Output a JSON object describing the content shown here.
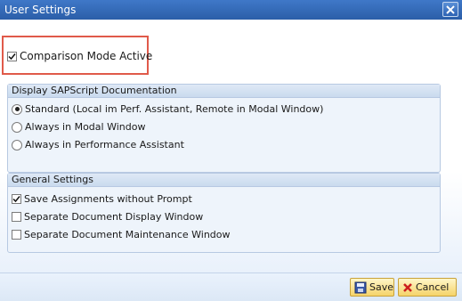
{
  "window": {
    "title": "User Settings",
    "close_icon": "close-icon"
  },
  "comparison_mode": {
    "label": "Comparison Mode Active",
    "checked": true
  },
  "doc_group": {
    "title": "Display SAPScript Documentation",
    "options": [
      {
        "label": "Standard (Local im Perf. Assistant, Remote in Modal Window)",
        "selected": true
      },
      {
        "label": "Always in Modal Window",
        "selected": false
      },
      {
        "label": "Always in Performance Assistant",
        "selected": false
      }
    ]
  },
  "general_group": {
    "title": "General Settings",
    "options": [
      {
        "label": "Save Assignments without Prompt",
        "checked": true
      },
      {
        "label": "Separate Document Display Window",
        "checked": false
      },
      {
        "label": "Separate Document Maintenance Window",
        "checked": false
      }
    ]
  },
  "buttons": {
    "save_label": "Save",
    "cancel_label": "Cancel"
  },
  "colors": {
    "title_bar": "#2b5ea8",
    "highlight": "#e05a4a",
    "button": "#f5d36a"
  }
}
